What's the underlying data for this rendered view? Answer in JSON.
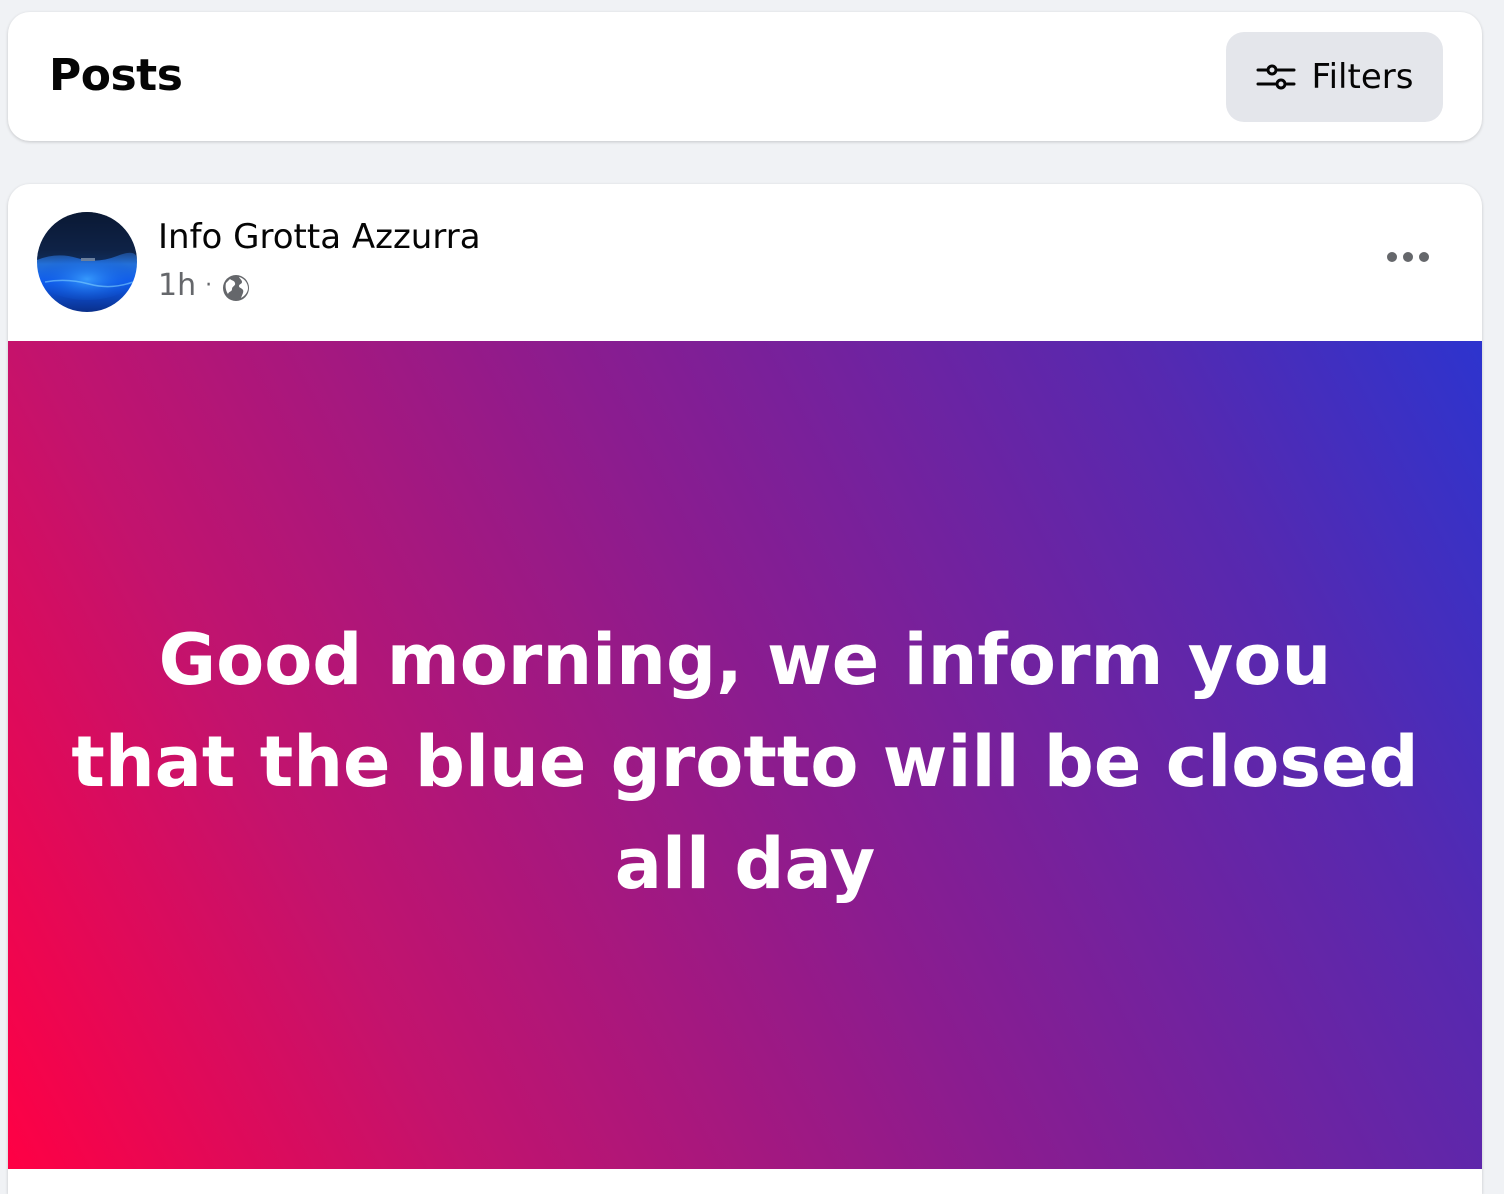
{
  "header": {
    "title": "Posts",
    "filters_label": "Filters",
    "filters_icon": "sliders-icon"
  },
  "post": {
    "author": "Info Grotta Azzurra",
    "time": "1h",
    "separator": "·",
    "audience_icon": "globe-icon",
    "more_icon": "more-horizontal-icon",
    "text": "Good morning, we inform you that the blue grotto will be closed all day",
    "gradient_colors": [
      "#ff0044",
      "#c3136d",
      "#8b1c8f",
      "#5629b0",
      "#2d34ce"
    ]
  },
  "colors": {
    "page_background": "#f0f2f5",
    "card_background": "#ffffff",
    "button_background": "#e4e6eb",
    "secondary_text": "#65676b"
  }
}
